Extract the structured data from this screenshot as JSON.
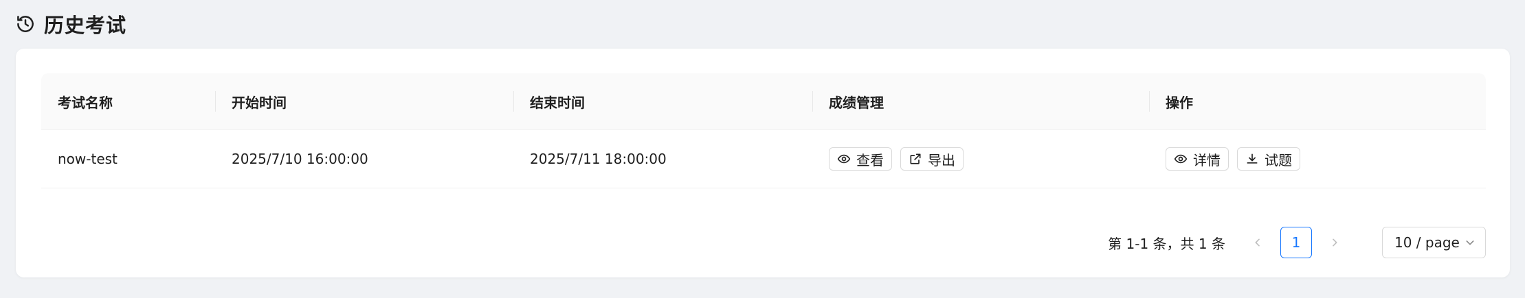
{
  "header": {
    "title": "历史考试",
    "icon": "clock-history-icon"
  },
  "table": {
    "columns": [
      "考试名称",
      "开始时间",
      "结束时间",
      "成绩管理",
      "操作"
    ],
    "rows": [
      {
        "name": "now-test",
        "start": "2025/7/10 16:00:00",
        "end": "2025/7/11 18:00:00",
        "score_actions": {
          "view": "查看",
          "export": "导出"
        },
        "actions": {
          "detail": "详情",
          "questions": "试题"
        }
      }
    ]
  },
  "pagination": {
    "total_text": "第 1-1 条，共 1 条",
    "current_page": "1",
    "page_size": "10 / page"
  },
  "colors": {
    "primary": "#1677ff",
    "background": "#f0f2f5",
    "card": "#ffffff"
  }
}
